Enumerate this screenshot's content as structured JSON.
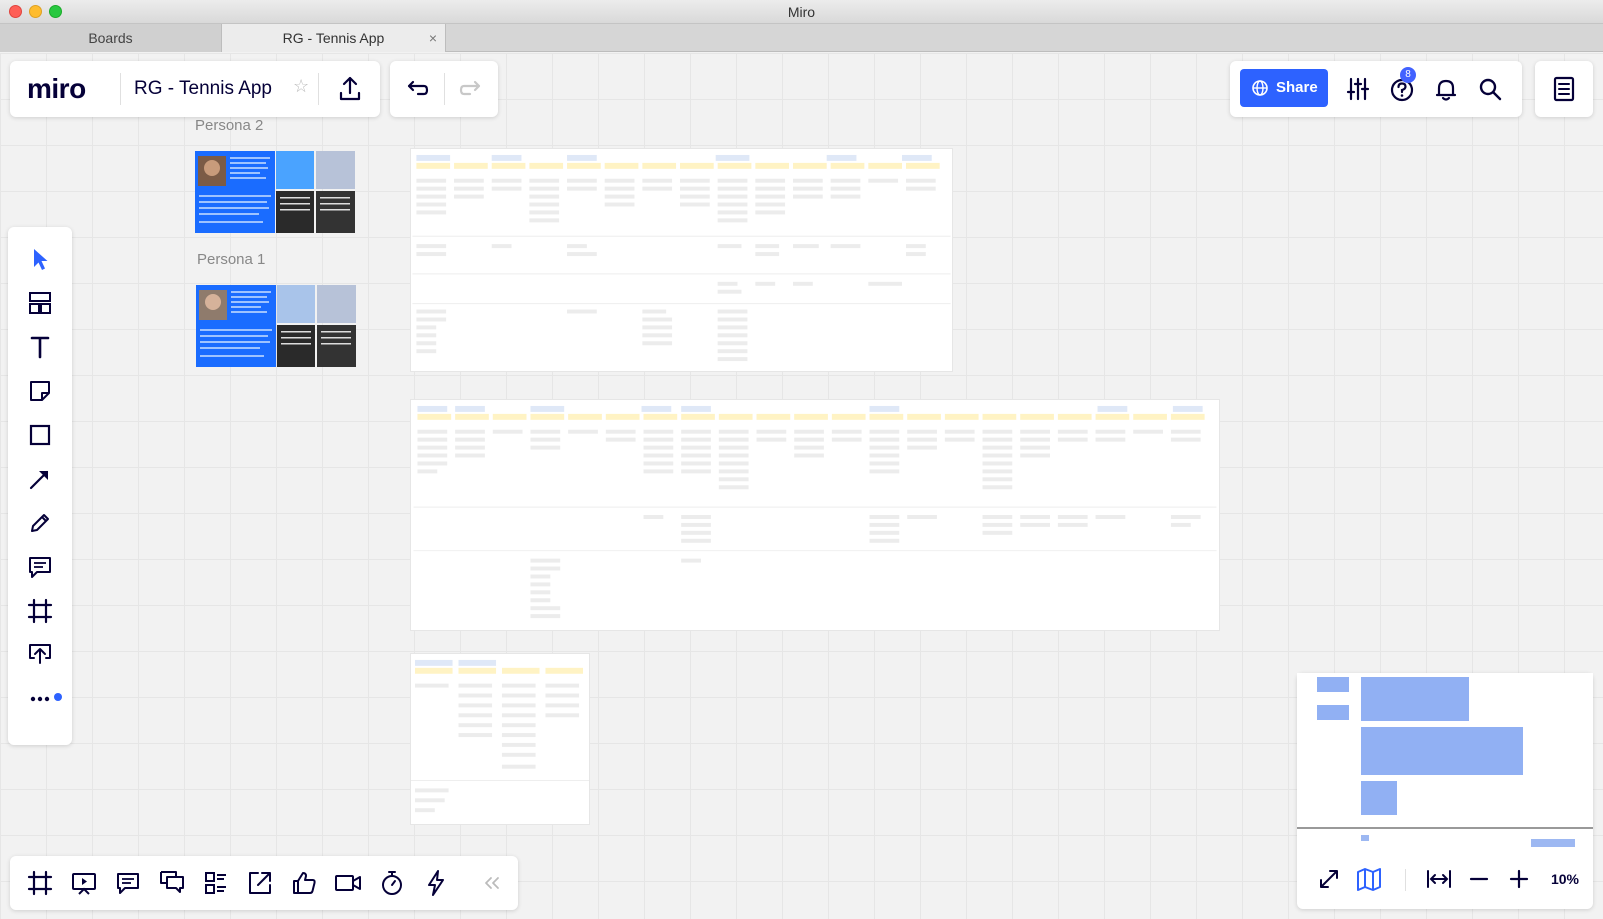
{
  "window": {
    "title": "Miro"
  },
  "tabs": [
    {
      "label": "Boards",
      "active": false
    },
    {
      "label": "RG - Tennis App",
      "active": true,
      "close": "×"
    }
  ],
  "header": {
    "logo": "miro",
    "board_name": "RG - Tennis App",
    "star": "☆",
    "share_label": "Share",
    "help_badge": "8"
  },
  "board": {
    "persona_labels": [
      "Persona 2",
      "Persona 1"
    ]
  },
  "minimap": {
    "zoom": "10%"
  },
  "colors": {
    "accent": "#2d62ff",
    "brand_dark": "#050038",
    "persona_blue": "#1a6cff"
  },
  "icons": {
    "left_toolbar": [
      "select-arrow-icon",
      "templates-icon",
      "text-icon",
      "sticky-note-icon",
      "shape-icon",
      "connection-line-icon",
      "pen-icon",
      "comment-icon",
      "frame-icon",
      "upload-icon",
      "more-icon"
    ],
    "bottom_toolbar": [
      "frames-icon",
      "presentation-icon",
      "comments-icon",
      "chat-icon",
      "cards-icon",
      "share-screen-icon",
      "voting-icon",
      "video-call-icon",
      "timer-icon",
      "activity-icon",
      "collapse-icon"
    ]
  }
}
